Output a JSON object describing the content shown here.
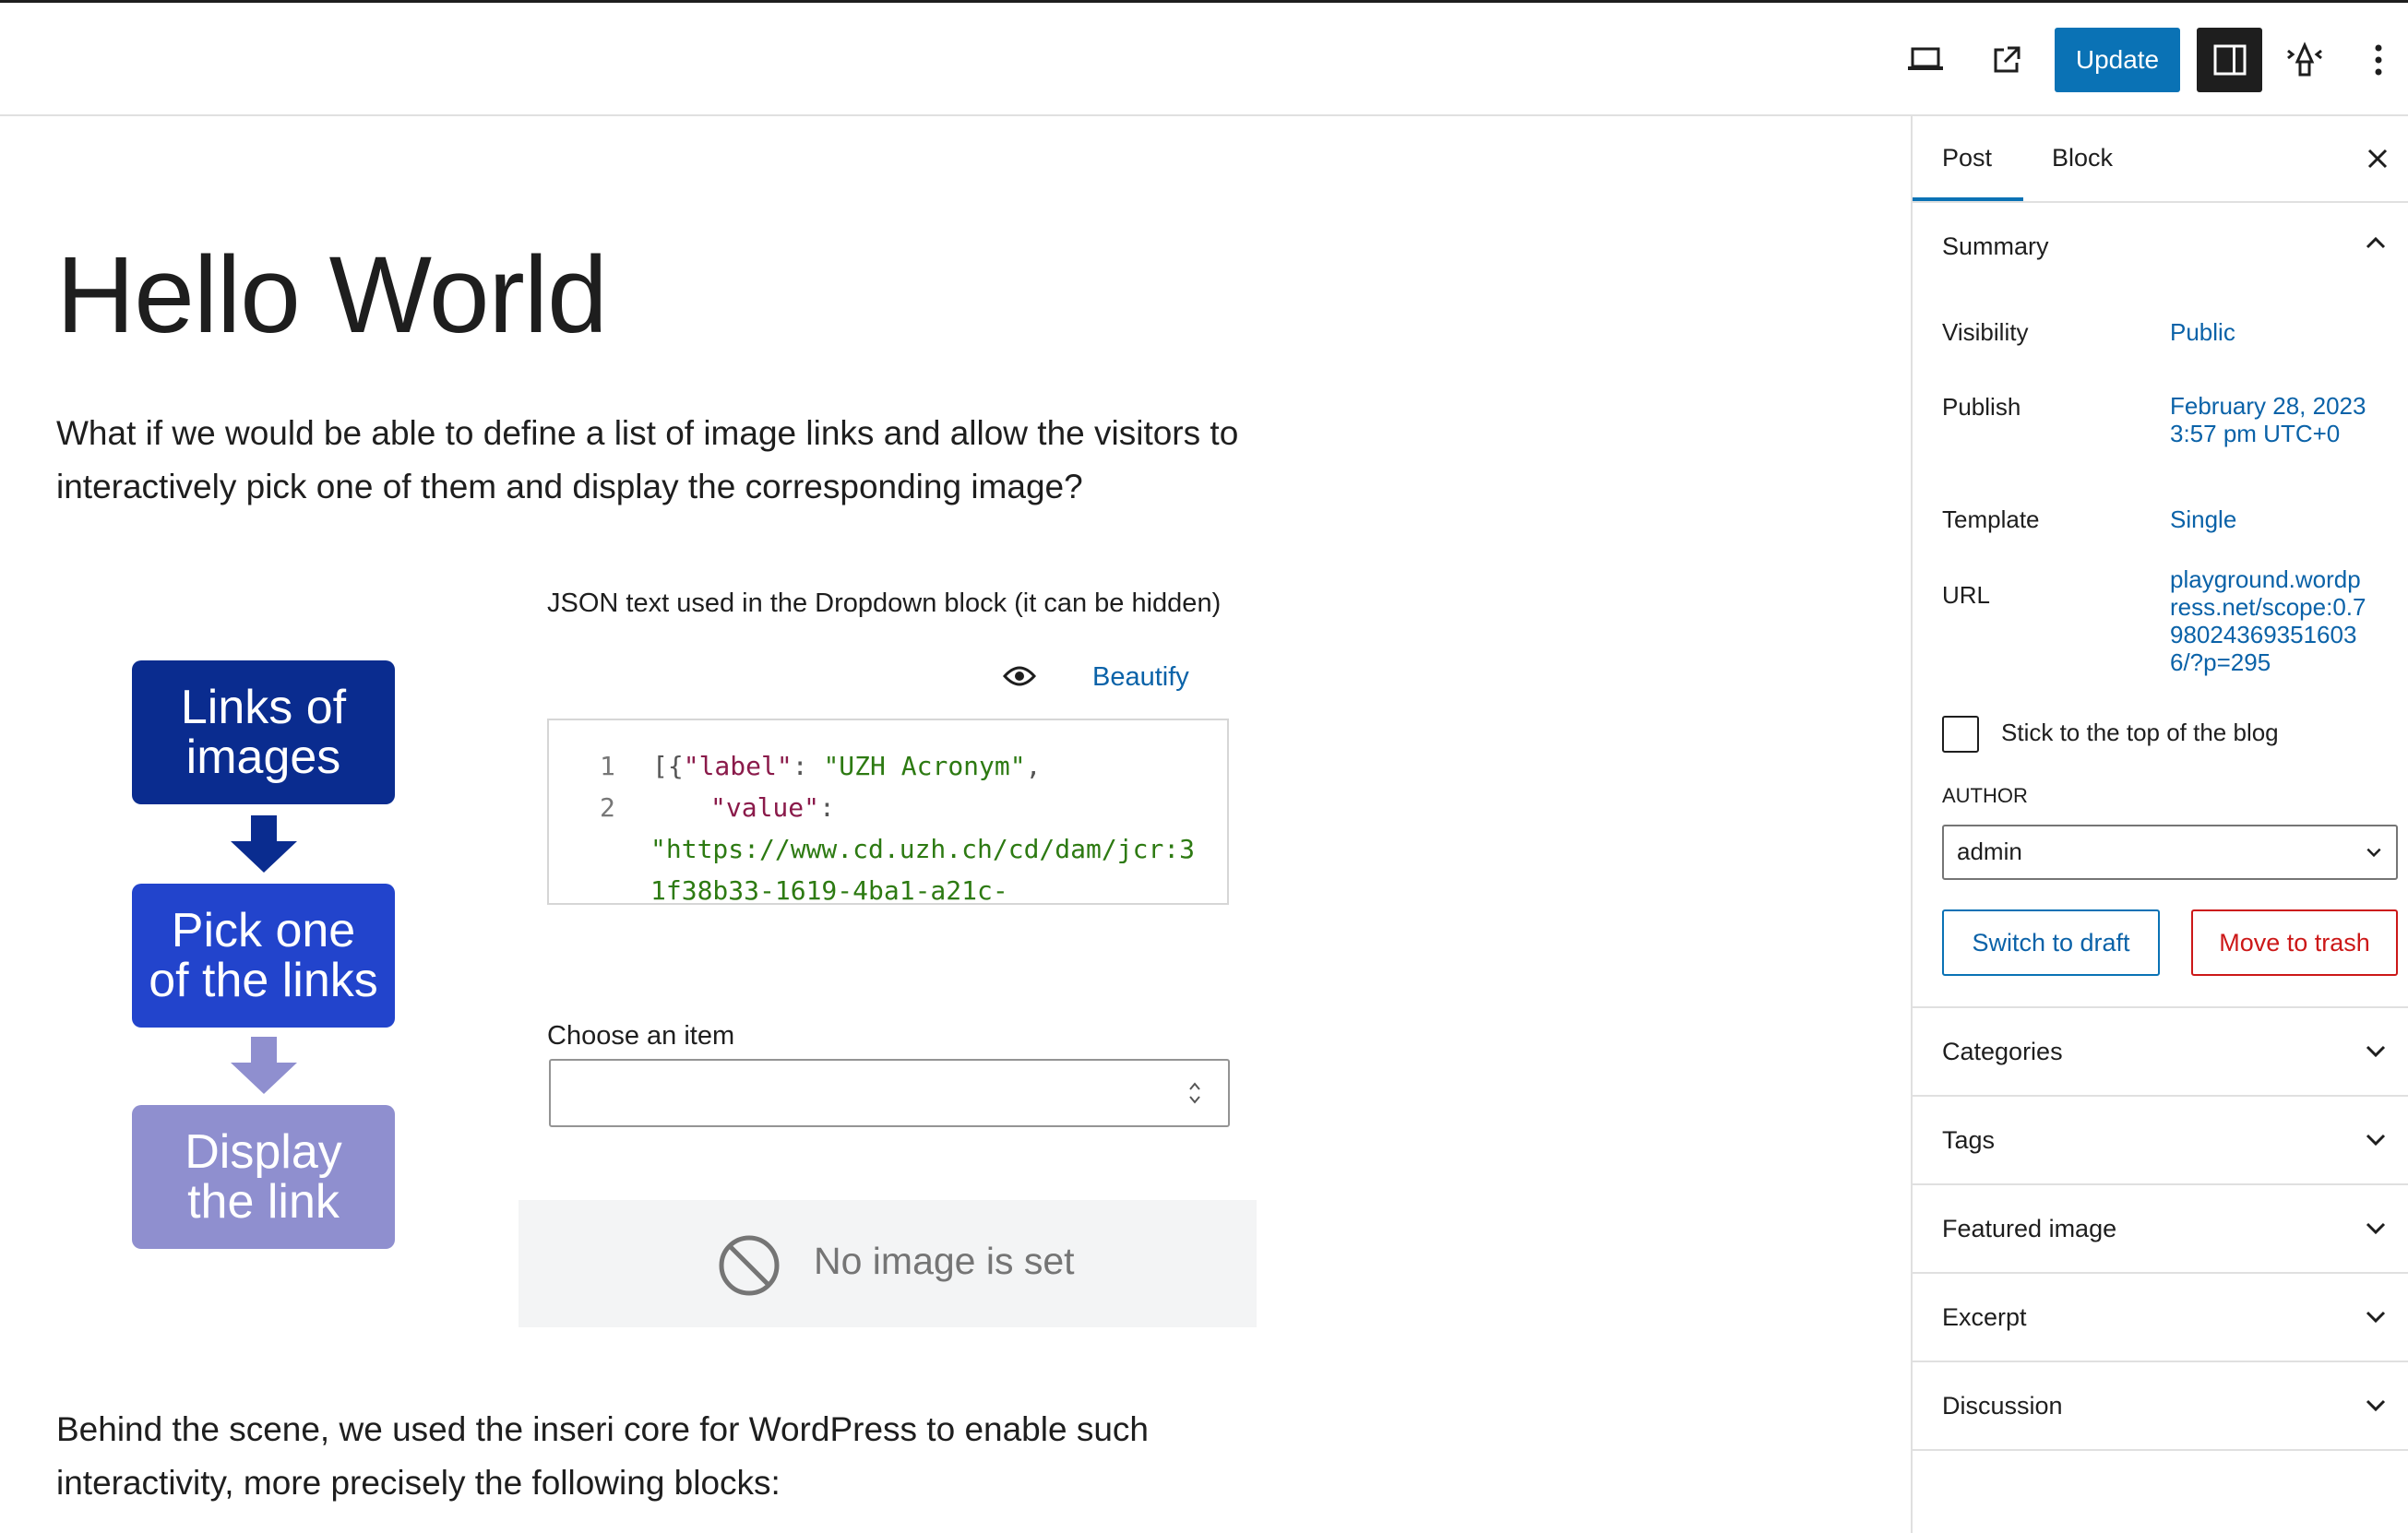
{
  "toolbar": {
    "update_label": "Update"
  },
  "editor": {
    "title": "Hello World",
    "intro_line1": "What if we would be able to define a list of image links and allow the visitors to",
    "intro_line2": "interactively pick one of them and display the corresponding image?",
    "flow": {
      "box1_line1": "Links of",
      "box1_line2": "images",
      "box2_line1": "Pick one",
      "box2_line2": "of the links",
      "box3_line1": "Display",
      "box3_line2": "the link",
      "colors": [
        "#0a2c8f",
        "#2244cc",
        "#8f8fcf"
      ]
    },
    "json_block": {
      "label": "JSON text used in the Dropdown block (it can be hidden)",
      "beautify_label": "Beautify",
      "line_numbers": [
        "1",
        "2"
      ],
      "code_l1_a": "[{",
      "code_l1_key": "\"label\"",
      "code_l1_colon": ": ",
      "code_l1_val": "\"UZH Acronym\"",
      "code_l1_end": ",",
      "code_l2_key": "\"value\"",
      "code_l2_colon": ":",
      "code_l3": "\"https://www.cd.uzh.ch/cd/dam/jcr:3",
      "code_l4": "1f38b33-1619-4ba1-a21c-"
    },
    "dropdown": {
      "label": "Choose an item",
      "value": ""
    },
    "image_placeholder": "No image is set",
    "outro_line1": "Behind the scene, we used the inseri core for WordPress to enable such",
    "outro_line2": "interactivity, more precisely the following blocks:"
  },
  "sidebar": {
    "tabs": [
      "Post",
      "Block"
    ],
    "summary": {
      "title": "Summary",
      "visibility_label": "Visibility",
      "visibility_value": "Public",
      "publish_label": "Publish",
      "publish_value_l1": "February 28, 2023",
      "publish_value_l2": "3:57 pm UTC+0",
      "template_label": "Template",
      "template_value": "Single",
      "url_label": "URL",
      "url_l1": "playground.wordp",
      "url_l2": "ress.net/scope:0.7",
      "url_l3": "98024369351603",
      "url_l4": "6/?p=295",
      "sticky_label": "Stick to the top of the blog",
      "author_label": "AUTHOR",
      "author_value": "admin",
      "switch_draft_label": "Switch to draft",
      "trash_label": "Move to trash"
    },
    "panels": [
      "Categories",
      "Tags",
      "Featured image",
      "Excerpt",
      "Discussion"
    ]
  },
  "colors": {
    "accent": "#0a72b5",
    "danger": "#cc1818",
    "dark": "#1e1e1e"
  }
}
